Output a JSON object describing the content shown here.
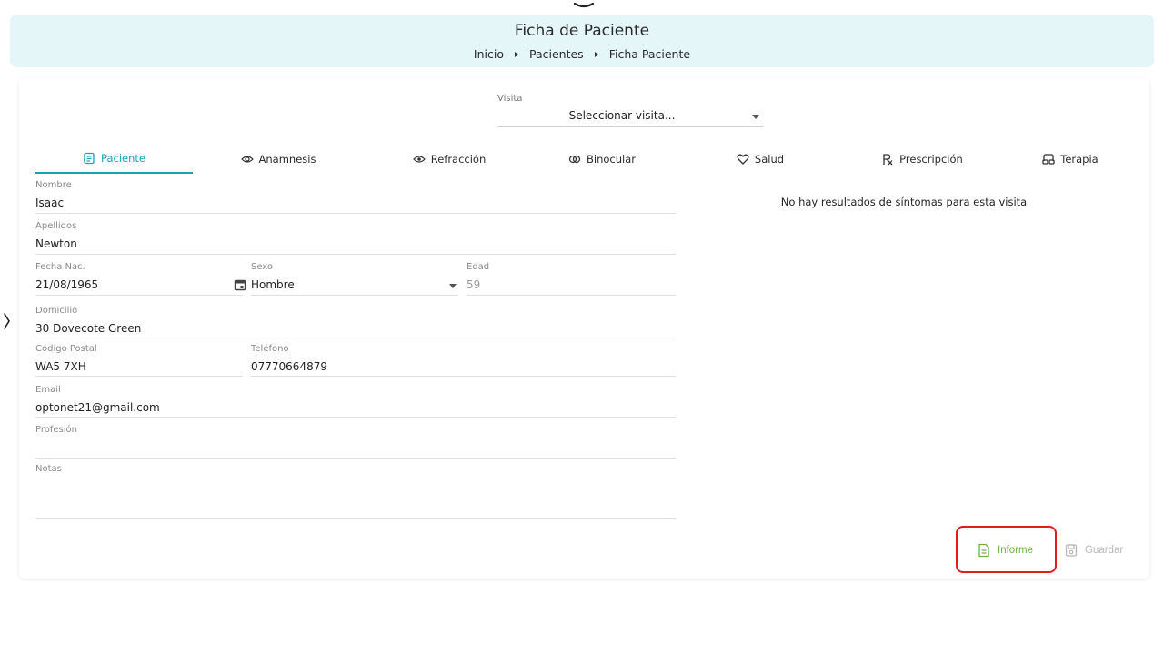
{
  "header": {
    "title": "Ficha de Paciente",
    "breadcrumb": [
      "Inicio",
      "Pacientes",
      "Ficha Paciente"
    ]
  },
  "visita": {
    "label": "Visita",
    "value": "Seleccionar visita..."
  },
  "tabs": [
    {
      "label": "Paciente",
      "icon": "contact-card-icon",
      "active": true
    },
    {
      "label": "Anamnesis",
      "icon": "eye-refresh-icon"
    },
    {
      "label": "Refracción",
      "icon": "eye-settings-icon"
    },
    {
      "label": "Binocular",
      "icon": "linked-circles-icon"
    },
    {
      "label": "Salud",
      "icon": "heart-icon"
    },
    {
      "label": "Prescripción",
      "icon": "rx-icon"
    },
    {
      "label": "Terapia",
      "icon": "glasses-icon"
    }
  ],
  "form": {
    "nombre": {
      "label": "Nombre",
      "value": "Isaac"
    },
    "apellidos": {
      "label": "Apellidos",
      "value": "Newton"
    },
    "fecha_nac": {
      "label": "Fecha Nac.",
      "value": "21/08/1965"
    },
    "sexo": {
      "label": "Sexo",
      "value": "Hombre"
    },
    "edad": {
      "label": "Edad",
      "value": "59"
    },
    "domicilio": {
      "label": "Domicilio",
      "value": "30 Dovecote Green"
    },
    "codigo_postal": {
      "label": "Código Postal",
      "value": "WA5 7XH"
    },
    "telefono": {
      "label": "Teléfono",
      "value": "07770664879"
    },
    "email": {
      "label": "Email",
      "value": "optonet21@gmail.com"
    },
    "profesion": {
      "label": "Profesión",
      "value": ""
    },
    "notas": {
      "label": "Notas",
      "value": ""
    }
  },
  "symptoms": {
    "empty_message": "No hay resultados de síntomas para esta visita"
  },
  "actions": {
    "informe_label": "Informe",
    "guardar_label": "Guardar"
  },
  "colors": {
    "accent": "#1aa3b5",
    "header_bg": "#e4f6f8",
    "informe": "#6bb23c",
    "highlight": "#e41b1b"
  }
}
